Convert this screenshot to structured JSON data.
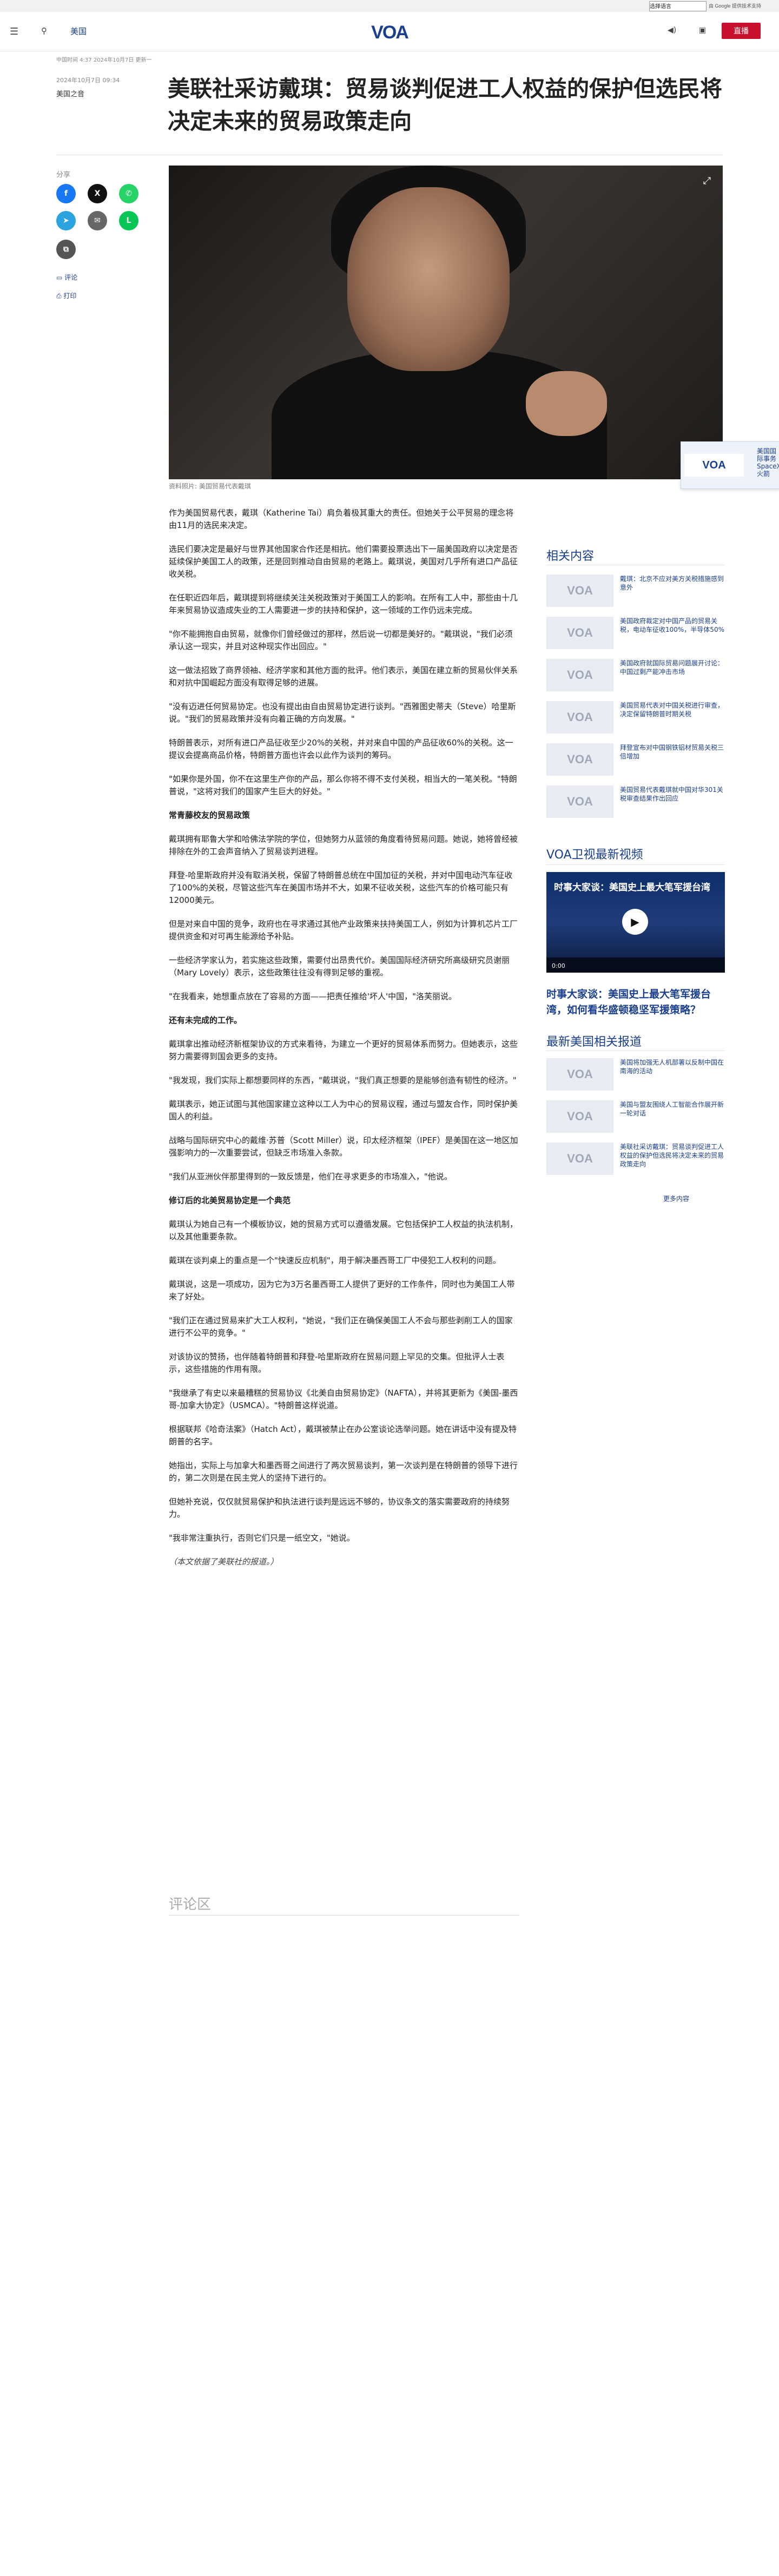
{
  "topbar": {
    "language_select": "选择语言",
    "google_badge": "由 Google 提供技术支持"
  },
  "header": {
    "section": "美国",
    "logo": "VOA",
    "donate": "直播"
  },
  "article_meta": {
    "kicker": "中国时间 4:37 2024年10月7日 更新一",
    "date": "2024年10月7日 09:34",
    "author": "美国之音"
  },
  "title": "美联社采访戴琪：贸易谈判促进工人权益的保护但选民将决定未来的贸易政策走向",
  "share": {
    "label": "分享",
    "comments_link": "评论",
    "print_link": "打印"
  },
  "hero": {
    "caption": "资料照片: 美国贸易代表戴琪"
  },
  "article": {
    "p1": "作为美国贸易代表，戴琪（Katherine Tai）肩负着极其重大的责任。但她关于公平贸易的理念将由11月的选民来决定。",
    "p2": "选民们要决定是最好与世界其他国家合作还是相抗。他们需要投票选出下一届美国政府以决定是否延续保护美国工人的政策，还是回到推动自由贸易的老路上。戴琪说，美国对几乎所有进口产品征收关税。",
    "p3": "在任职近四年后，戴琪提到将继续关注关税政策对于美国工人的影响。在所有工人中，那些由十几年来贸易协议造成失业的工人需要进一步的扶持和保护，这一领域的工作仍远未完成。",
    "p4": "\"你不能拥抱自由贸易，就像你们曾经做过的那样，然后说一切都是美好的。\"戴琪说，\"我们必须承认这一现实，并且对这种现实作出回应。\"",
    "p5": "这一做法招致了商界领袖、经济学家和其他方面的批评。他们表示，美国在建立新的贸易伙伴关系和对抗中国崛起方面没有取得足够的进展。",
    "p6": "\"没有迈进任何贸易协定。也没有提出由自由贸易协定进行谈判。\"西雅图史蒂夫（Steve）哈里斯说。\"我们的贸易政策并没有向着正确的方向发展。\"",
    "p7": "特朗普表示，对所有进口产品征收至少20%的关税，并对来自中国的产品征收60%的关税。这一提议会提高商品价格，特朗普方面也许会以此作为谈判的筹码。",
    "p8": "\"如果你是外国，你不在这里生产你的产品，那么你将不得不支付关税，相当大的一笔关税。\"特朗普说，\"这将对我们的国家产生巨大的好处。\"",
    "sub1": "常青藤校友的贸易政策",
    "p9": "戴琪拥有耶鲁大学和哈佛法学院的学位，但她努力从蓝领的角度看待贸易问题。她说，她将曾经被排除在外的工会声音纳入了贸易谈判进程。",
    "p10": "拜登-哈里斯政府并没有取消关税，保留了特朗普总统在中国加征的关税，并对中国电动汽车征收了100%的关税，尽管这些汽车在美国市场并不大，如果不征收关税，这些汽车的价格可能只有12000美元。",
    "p11": "但是对来自中国的竞争，政府也在寻求通过其他产业政策来扶持美国工人，例如为计算机芯片工厂提供资金和对可再生能源给予补贴。",
    "p12": "一些经济学家认为，若实施这些政策，需要付出昂贵代价。美国国际经济研究所高级研究员谢丽（Mary Lovely）表示，这些政策往往没有得到足够的重视。",
    "p13": "\"在我看来，她想重点放在了容易的方面——把责任推给'坏人'中国，\"洛芙丽说。",
    "sub2": "还有未完成的工作。",
    "p14": "戴琪拿出推动经济新框架协议的方式来看待，为建立一个更好的贸易体系而努力。但她表示，这些努力需要得到国会更多的支持。",
    "p15": "\"我发现，我们实际上都想要同样的东西，\"戴琪说，\"我们真正想要的是能够创造有韧性的经济。\"",
    "p16": "戴琪表示，她正试图与其他国家建立这种以工人为中心的贸易议程，通过与盟友合作，同时保护美国人的利益。",
    "p17": "战略与国际研究中心的戴维·苏普（Scott Miller）说，印太经济框架（IPEF）是美国在这一地区加强影响力的一次重要尝试，但缺乏市场准入条款。",
    "p18": "\"我们从亚洲伙伴那里得到的一致反馈是，他们在寻求更多的市场准入，\"他说。",
    "sub3": "修订后的北美贸易协定是一个典范",
    "p19": "戴琪认为她自己有一个模板协议，她的贸易方式可以遵循发展。它包括保护工人权益的执法机制，以及其他重要条款。",
    "p20": "戴琪在谈判桌上的重点是一个\"快速反应机制\"，用于解决墨西哥工厂中侵犯工人权利的问题。",
    "p21": "戴琪说，这是一项成功，因为它为3万名墨西哥工人提供了更好的工作条件，同时也为美国工人带来了好处。",
    "p22": "\"我们正在通过贸易来扩大工人权利，\"她说，\"我们正在确保美国工人不会与那些剥削工人的国家进行不公平的竞争。\"",
    "p23": "对该协议的赞扬，也伴随着特朗普和拜登-哈里斯政府在贸易问题上罕见的交集。但批评人士表示，这些措施的作用有限。",
    "p24": "\"我继承了有史以来最糟糕的贸易协议《北美自由贸易协定》（NAFTA），并将其更新为《美国-墨西哥-加拿大协定》（USMCA）。\"特朗普这样说道。",
    "p25": "根据联邦《哈奇法案》（Hatch Act），戴琪被禁止在办公室谈论选举问题。她在讲话中没有提及特朗普的名字。",
    "p26": "她指出，实际上与加拿大和墨西哥之间进行了两次贸易谈判，第一次谈判是在特朗普的领导下进行的，第二次则是在民主党人的坚持下进行的。",
    "p27": "但她补充说，仅仅就贸易保护和执法进行谈判是远远不够的，协议条文的落实需要政府的持续努力。",
    "p28": "\"我非常注重执行，否则它们只是一纸空文，\"她说。",
    "credit": "（本文依据了美联社的报道。）"
  },
  "comments": {
    "heading": "评论区"
  },
  "floating_promo": {
    "text": "美国国际事务 SpaceX 火箭"
  },
  "sidebar": {
    "related_heading": "相关内容",
    "related": [
      "戴琪：北京不应对美方关税措施感到意外",
      "美国政府裁定对中国产品的贸易关税，电动车征收100%，半导体50%",
      "美国政府就国际贸易问题展开讨论：中国过剩产能冲击市场",
      "美国贸易代表对中国关税进行审查，决定保留特朗普时期关税",
      "拜登宣布对中国钢铁铝材贸易关税三倍增加",
      "美国贸易代表戴琪就中国对华301关税审查结果作出回应"
    ],
    "video_heading": "VOA卫视最新视频",
    "video": {
      "overlay_title": "时事大家谈：美国史上最大笔军援台湾",
      "duration": "0:00",
      "caption": "时事大家谈：美国史上最大笔军援台湾，如何看华盛顿稳坚军援策略？"
    },
    "latest_heading": "最新美国相关报道",
    "latest": [
      "美国将加强无人机部署以反制中国在南海的活动",
      "美国与盟友围绕人工智能合作展开新一轮对话",
      "美联社采访戴琪：贸易谈判促进工人权益的保护但选民将决定未来的贸易政策走向"
    ],
    "more_link": "更多内容"
  },
  "colors": {
    "accent": "#1a3f8f",
    "donate": "#c8102e"
  },
  "icons": [
    "hamburger-icon",
    "search-icon",
    "facebook-icon",
    "x-icon",
    "whatsapp-icon",
    "telegram-icon",
    "email-icon",
    "line-icon",
    "copy-link-icon",
    "comment-icon",
    "print-icon",
    "expand-icon",
    "play-icon"
  ]
}
